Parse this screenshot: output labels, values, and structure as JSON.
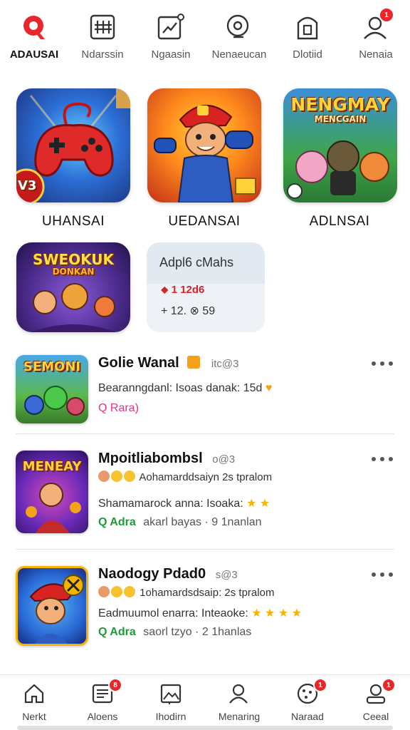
{
  "top_tabs": [
    {
      "label": "ADAUSAI",
      "icon": "app-logo-icon",
      "active": true
    },
    {
      "label": "Ndarssin",
      "icon": "grid-icon"
    },
    {
      "label": "Ngaasin",
      "icon": "chart-icon"
    },
    {
      "label": "Nenaeucan",
      "icon": "search-icon"
    },
    {
      "label": "Dlotiid",
      "icon": "bag-icon"
    },
    {
      "label": "Nenaia",
      "icon": "profile-icon",
      "badge": "1"
    }
  ],
  "tiles": [
    {
      "label": "UHANSAI",
      "art_text": "V3"
    },
    {
      "label": "UEDANSAI",
      "art_text": ""
    },
    {
      "label": "ADLNSAI",
      "art_text": "NENGMAY",
      "art_sub": "MENCGAIN"
    },
    {
      "label": "",
      "art_text": "SWEOKUK",
      "art_sub": "DONKAN"
    }
  ],
  "info_card": {
    "title": "Adpl6 cMahs",
    "row1_prefix": "⬥",
    "row1_value": "1 12d6",
    "row2": "+ 12. ⊗ 59"
  },
  "list": [
    {
      "art_text": "SEMONI",
      "title": "Golie Wanal",
      "title_sub": "itc@3",
      "line1": "Bearanngdanl: Isoas danak: 15d",
      "line2_tag": "Q Rara)",
      "line2_tag_color": "pink",
      "line2_rest": ""
    },
    {
      "art_text": "MENEAY",
      "title": "Mpoitliabombsl",
      "title_sub": "o@3",
      "line1": "Aohamarddsaiyn 2s tpralom",
      "line2": "Shamamarock anna: Isoaka:",
      "stars2": "★ ★",
      "line3_tag": "Q Adra",
      "line3_rest": "akarl bayas · 9 1nanlan"
    },
    {
      "art_text": "",
      "title": "Naodogy Pdad0",
      "title_sub": "s@3",
      "line1": "1ohamardsdsaip: 2s tpralom",
      "line2": "Eadmuumol enarra: Inteaoke:",
      "stars2": "★ ★ ★ ★",
      "line3_tag": "Q Adra",
      "line3_rest": "saorl tzyo · 2 1hanlas"
    }
  ],
  "bottom_nav": [
    {
      "label": "Nerkt",
      "icon": "home-icon"
    },
    {
      "label": "Aloens",
      "icon": "news-icon",
      "badge": "8"
    },
    {
      "label": "Ihodirn",
      "icon": "image-icon"
    },
    {
      "label": "Menaring",
      "icon": "user-icon"
    },
    {
      "label": "Naraad",
      "icon": "cookie-icon",
      "badge": "1"
    },
    {
      "label": "Ceeal",
      "icon": "account-icon",
      "badge": "1"
    }
  ],
  "colors": {
    "accent": "#e8262c",
    "green": "#1f9a3a",
    "pink": "#e0338a",
    "star": "#f4b400"
  }
}
